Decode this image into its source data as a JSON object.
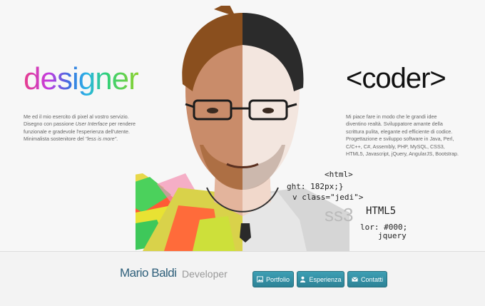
{
  "designer": {
    "title": "designer",
    "line1": "Me ed il mio esercito di pixel al vostro servizio.",
    "line2a": "Disegno con passione ",
    "line2b": "User Interface",
    "line2c": " per rendere",
    "line3": "funzionale e gradevole l'esperienza dell'utente.",
    "line4a": "Minimalista sostenitore del ",
    "line4b": "\"less is more\"",
    "line4c": "."
  },
  "coder": {
    "title": "<coder>",
    "lines": [
      "Mi piace fare in modo che le grandi idee",
      "diventino realtà. Sviluppatore amante della",
      "scrittura pulita, elegante ed efficiente di codice.",
      "Progettazione e sviluppo software in Java, Perl,",
      "C/C++, C#, Assembly, PHP, MySQL, CSS3,",
      "HTML5, Javascript, jQuery, AngularJS, Bootstrap."
    ]
  },
  "code_overlay": {
    "html_tag": "<html>",
    "height": "ght: 182px;}",
    "div": "v class=\"jedi\">",
    "css3": "ss3",
    "html5": "HTML5",
    "color": "lor: #000;",
    "jquery": "jquery"
  },
  "profile": {
    "name": "Mario Baldi",
    "role": "Developer"
  },
  "nav": {
    "portfolio": "Portfolio",
    "esperienza": "Esperienza",
    "contatti": "Contatti"
  },
  "colors": {
    "button": "#3394aa",
    "name": "#2e5f7a"
  }
}
